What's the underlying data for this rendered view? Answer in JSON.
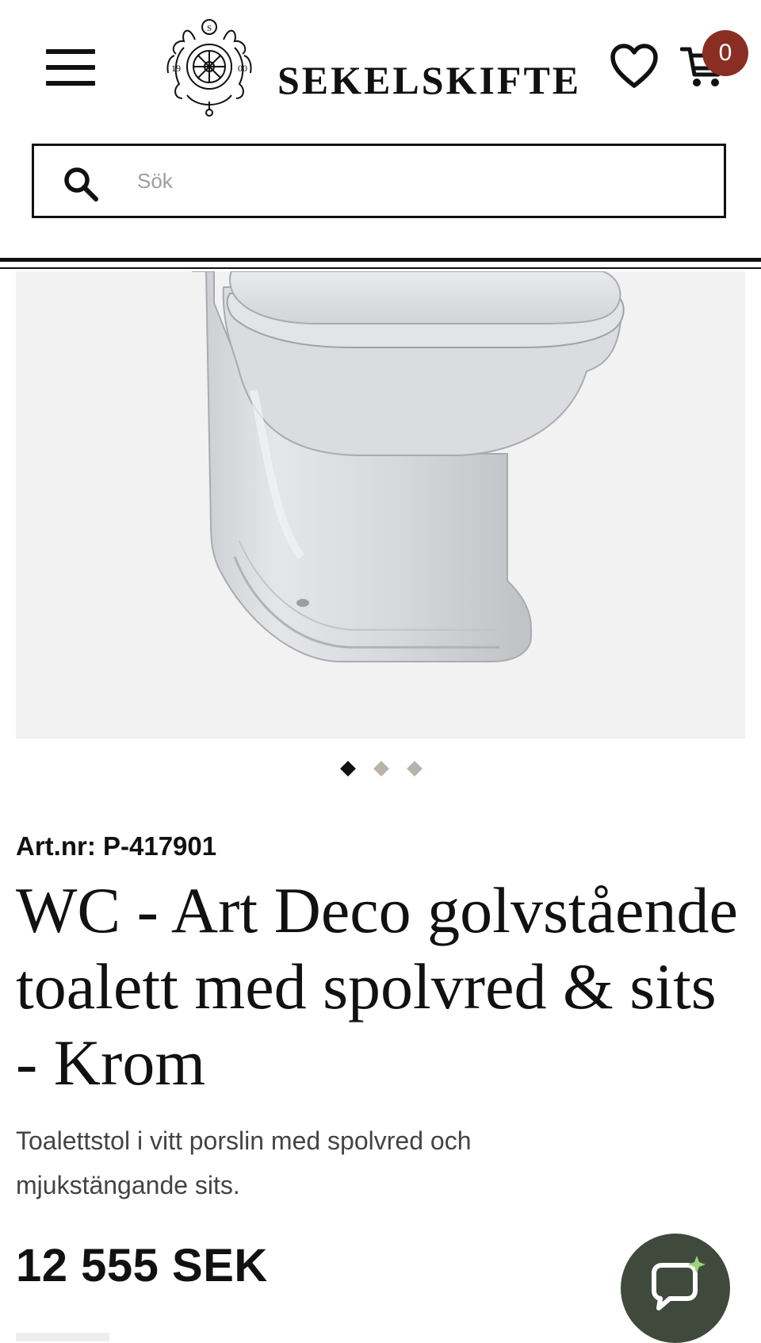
{
  "header": {
    "menu_label": "Meny",
    "logo": {
      "brand": "SEKELSKIFTE",
      "emblem_letter": "S",
      "emblem_year_left": "19",
      "emblem_year_right": "00"
    },
    "cart_count": "0",
    "colors": {
      "badge": "#8a2e24",
      "text": "#111111"
    }
  },
  "search": {
    "placeholder": "Sök",
    "value": "",
    "icon": "search-icon"
  },
  "gallery": {
    "image": "product-image-toilet",
    "total_slides": 3,
    "active_slide": 1
  },
  "product": {
    "art_nr": "Art.nr: P-417901",
    "title": "WC - Art Deco golvstående toalett med spolvred & sits - Krom",
    "description": "Toalettstol i vitt porslin med spolvred och mjukstängande sits.",
    "price": "12 555 SEK"
  },
  "chat": {
    "icon": "chat-icon",
    "color": "#3f4a3c"
  }
}
